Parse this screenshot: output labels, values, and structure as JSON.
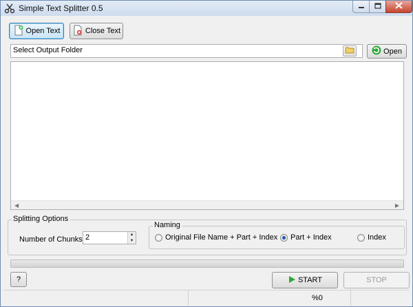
{
  "window": {
    "title": "Simple Text Splitter 0.5"
  },
  "toolbar": {
    "open_text_label": "Open Text",
    "close_text_label": "Close Text"
  },
  "output_folder": {
    "value": "Select Output Folder",
    "open_label": "Open"
  },
  "text_area": {
    "content": ""
  },
  "splitting_options": {
    "title": "Splitting Options",
    "chunks_label": "Number of Chunks:",
    "chunks_value": "2",
    "naming": {
      "title": "Naming",
      "options": [
        {
          "label": "Original File Name + Part + Index",
          "checked": false
        },
        {
          "label": "Part + Index",
          "checked": true
        },
        {
          "label": "Index",
          "checked": false
        }
      ]
    }
  },
  "progress": {
    "value": 0
  },
  "actions": {
    "help_label": "?",
    "start_label": "START",
    "stop_label": "STOP"
  },
  "status": {
    "percent_text": "%0"
  },
  "colors": {
    "accent": "#3c7fb1",
    "start_icon": "#2fa83b",
    "close_button": "#c4452f"
  },
  "icons": {
    "app": "scissors-icon",
    "open_text": "new-document-icon",
    "close_text": "close-document-icon",
    "folder": "folder-icon",
    "open_folder": "green-refresh-icon",
    "start": "play-icon"
  }
}
